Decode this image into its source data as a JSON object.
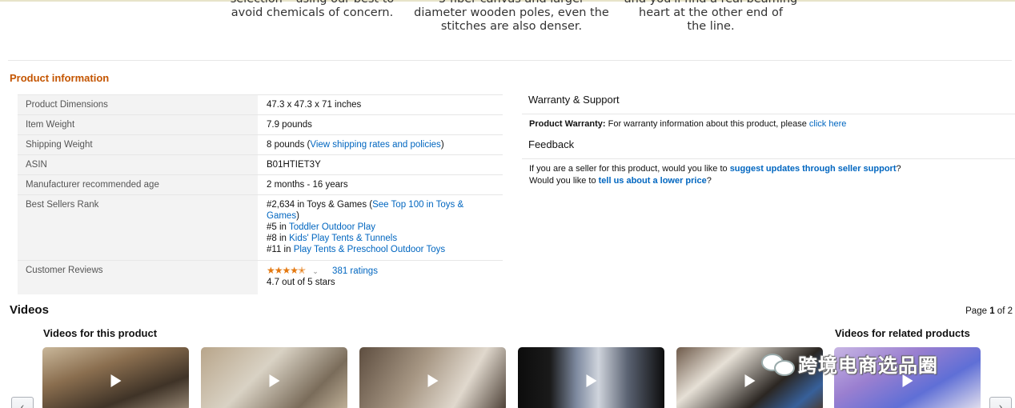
{
  "banner_captions": [
    "selection – using our best to\navoid chemicals of concern.",
    "5 fiber canvas and larger\ndiameter wooden poles, even the\nstitches are also denser.",
    "and you'll find a real beaming\nheart at the other end of\nthe line."
  ],
  "product_information": {
    "title": "Product information",
    "rows": [
      {
        "label": "Product Dimensions",
        "value": "47.3 x 47.3 x 71 inches"
      },
      {
        "label": "Item Weight",
        "value": "7.9 pounds"
      },
      {
        "label": "Shipping Weight",
        "value": "8 pounds (",
        "link": "View shipping rates and policies",
        "suffix": ")"
      },
      {
        "label": "ASIN",
        "value": "B01HTIET3Y"
      },
      {
        "label": "Manufacturer recommended age",
        "value": "2 months - 16 years"
      },
      {
        "label": "Best Sellers Rank",
        "lines": [
          {
            "prefix": "#2,634 in Toys & Games (",
            "link": "See Top 100 in Toys & Games",
            "suffix": ")"
          },
          {
            "prefix": "#5 in ",
            "link": "Toddler Outdoor Play",
            "suffix": ""
          },
          {
            "prefix": "#8 in ",
            "link": "Kids' Play Tents & Tunnels",
            "suffix": ""
          },
          {
            "prefix": "#11 in ",
            "link": "Play Tents & Preschool Outdoor Toys",
            "suffix": ""
          }
        ]
      },
      {
        "label": "Customer Reviews",
        "stars": "★★★★✭",
        "rating_value": 4.7,
        "ratings_link": "381 ratings",
        "rating_text": "4.7 out of 5 stars"
      }
    ]
  },
  "warranty": {
    "heading": "Warranty & Support",
    "label": "Product Warranty:",
    "text": " For warranty information about this product, please ",
    "link": "click here"
  },
  "feedback": {
    "heading": "Feedback",
    "line1_prefix": "If you are a seller for this product, would you like to ",
    "line1_link": "suggest updates through seller support",
    "line1_suffix": "?",
    "line2_prefix": "Would you like to ",
    "line2_link": "tell us about a lower price",
    "line2_suffix": "?"
  },
  "videos": {
    "title": "Videos",
    "page_label": "Page ",
    "page_current": "1",
    "page_of": " of 2",
    "left_heading": "Videos for this product",
    "right_heading": "Videos for related products",
    "prev_icon": "chevron-left-icon",
    "next_icon": "chevron-right-icon"
  },
  "watermark": {
    "text": "跨境电商选品圈"
  }
}
